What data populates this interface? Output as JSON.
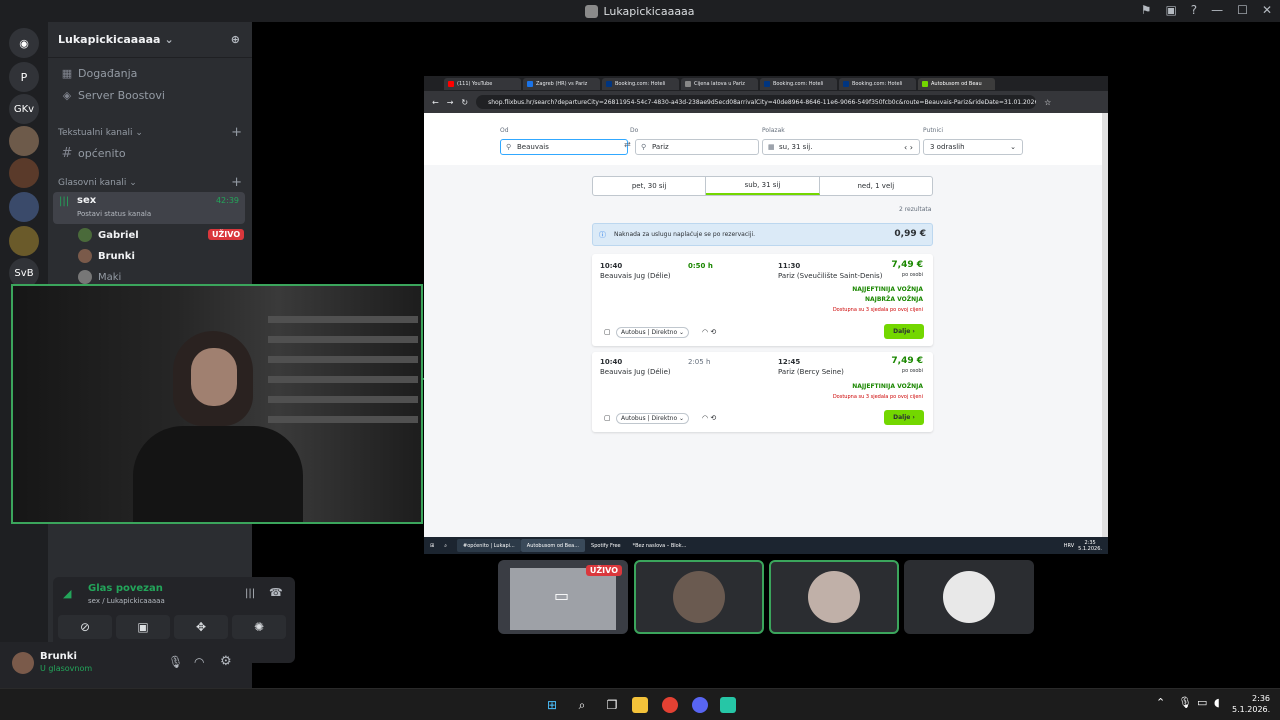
{
  "window": {
    "title": "Lukapickicaaaaa"
  },
  "rail": {
    "items": [
      {
        "label": "P"
      },
      {
        "label": "GKv"
      },
      {
        "label": "SvB"
      }
    ]
  },
  "sidebar": {
    "server_name": "Lukapickicaaaaa",
    "events": "Događanja",
    "boosts": "Server Boostovi",
    "text_category": "Tekstualni kanali",
    "text_channel": "općenito",
    "voice_category": "Glasovni kanali",
    "voice_channel": "sex",
    "voice_timer": "42:39",
    "voice_status": "Postavi status kanala",
    "members": [
      {
        "name": "Gabriel",
        "badge": "UŽIVO"
      },
      {
        "name": "Brunki"
      },
      {
        "name": "Maki"
      }
    ]
  },
  "voice_panel": {
    "title": "Glas povezan",
    "subtitle": "sex / Lukapickicaaaaa"
  },
  "user_bar": {
    "name": "Brunki",
    "status": "U glasovnom"
  },
  "share": {
    "tabs": [
      "(111) YouTube",
      "Zagreb (HR) vs Pariz",
      "Booking.com: Hoteli",
      "Cijena latova u Pariz",
      "Booking.com: Hoteli",
      "Booking.com: Hoteli",
      "Autobusom od Beau"
    ],
    "url": "shop.flixbus.hr/search?departureCity=26811954-54c7-4830-a43d-238ae9d5ecd08arrivalCity=40de8964-8646-11e6-9066-549f350fcb0c&route=Beauvais-Pariz&rideDate=31.01.2026&adu...",
    "search": {
      "from_label": "Od",
      "from_value": "Beauvais",
      "to_label": "Do",
      "to_value": "Pariz",
      "date_label": "Polazak",
      "date_value": "su, 31 sij.",
      "pax_label": "Putnici",
      "pax_value": "3 odraslih"
    },
    "dates": [
      "pet, 30 sij",
      "sub, 31 sij",
      "ned, 1 velj"
    ],
    "results_count": "2 rezultata",
    "fee_notice": "Naknada za uslugu naplaćuje se po rezervaciji.",
    "fee_amount": "0,99 €",
    "rides": [
      {
        "dep_time": "10:40",
        "dep_stop": "Beauvais Jug (Délie)",
        "duration": "0:50 h",
        "arr_time": "11:30",
        "arr_stop": "Pariz (Sveučilište Saint-Denis)",
        "price": "7,49 €",
        "per": "po osobi",
        "tag1": "NAJJEFTINIJA VOŽNJA",
        "tag2": "NAJBRŽA VOŽNJA",
        "seats": "Dostupna su 3 sjedala po ovoj cijeni",
        "mode": "Autobus",
        "type": "Direktno",
        "cta": "Dalje"
      },
      {
        "dep_time": "10:40",
        "dep_stop": "Beauvais Jug (Délie)",
        "duration": "2:05 h",
        "arr_time": "12:45",
        "arr_stop": "Pariz (Bercy Seine)",
        "price": "7,49 €",
        "per": "po osobi",
        "tag1": "NAJJEFTINIJA VOŽNJA",
        "seats": "Dostupna su 3 sjedala po ovoj cijeni",
        "mode": "Autobus",
        "type": "Direktno",
        "cta": "Dalje"
      }
    ],
    "win_taskbar": [
      "#općenito | Lukapi...",
      "Autobusom od Bea...",
      "Spotify Free",
      "*Bez naslova – Blok..."
    ],
    "win_tray": {
      "lang": "HRV",
      "time": "2:35",
      "date": "5.1.2026."
    }
  },
  "live_badge": "UŽIVO",
  "taskbar": {
    "time": "2:36",
    "date": "5.1.2026."
  }
}
